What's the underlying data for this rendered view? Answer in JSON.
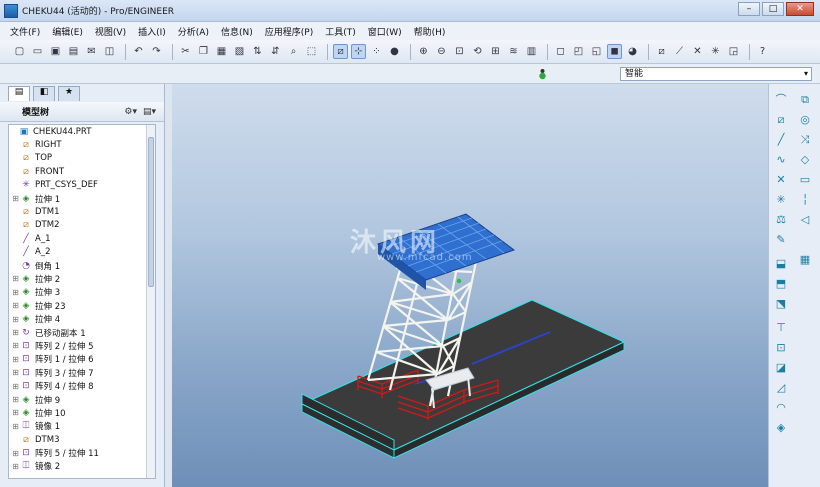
{
  "window": {
    "title": "CHEKU44 (活动的) - Pro/ENGINEER",
    "min": "–",
    "max": "□",
    "close": "✕"
  },
  "menu": [
    "文件(F)",
    "编辑(E)",
    "视图(V)",
    "插入(I)",
    "分析(A)",
    "信息(N)",
    "应用程序(P)",
    "工具(T)",
    "窗口(W)",
    "帮助(H)"
  ],
  "filter": {
    "value": "智能",
    "arrow": "▾"
  },
  "left_panel": {
    "tabs": [
      "▤",
      "◧",
      "★"
    ],
    "tree_title": "模型树",
    "tree_tools": [
      "⚙▾",
      "▤▾"
    ],
    "items": [
      {
        "exp": "",
        "icon": "▣",
        "label": "CHEKU44.PRT"
      },
      {
        "exp": "",
        "icon": "⧄",
        "label": "RIGHT"
      },
      {
        "exp": "",
        "icon": "⧄",
        "label": "TOP"
      },
      {
        "exp": "",
        "icon": "⧄",
        "label": "FRONT"
      },
      {
        "exp": "",
        "icon": "✳",
        "label": "PRT_CSYS_DEF"
      },
      {
        "exp": "⊞",
        "icon": "◈",
        "label": "拉伸 1"
      },
      {
        "exp": "",
        "icon": "⧄",
        "label": "DTM1"
      },
      {
        "exp": "",
        "icon": "⧄",
        "label": "DTM2"
      },
      {
        "exp": "",
        "icon": "╱",
        "label": "A_1"
      },
      {
        "exp": "",
        "icon": "╱",
        "label": "A_2"
      },
      {
        "exp": "",
        "icon": "◔",
        "label": "倒角 1"
      },
      {
        "exp": "⊞",
        "icon": "◈",
        "label": "拉伸 2"
      },
      {
        "exp": "⊞",
        "icon": "◈",
        "label": "拉伸 3"
      },
      {
        "exp": "⊞",
        "icon": "◈",
        "label": "拉伸 23"
      },
      {
        "exp": "⊞",
        "icon": "◈",
        "label": "拉伸 4"
      },
      {
        "exp": "⊞",
        "icon": "↻",
        "label": "已移动副本 1"
      },
      {
        "exp": "⊞",
        "icon": "⊡",
        "label": "阵列 2 / 拉伸 5"
      },
      {
        "exp": "⊞",
        "icon": "⊡",
        "label": "阵列 1 / 拉伸 6"
      },
      {
        "exp": "⊞",
        "icon": "⊡",
        "label": "阵列 3 / 拉伸 7"
      },
      {
        "exp": "⊞",
        "icon": "⊡",
        "label": "阵列 4 / 拉伸 8"
      },
      {
        "exp": "⊞",
        "icon": "◈",
        "label": "拉伸 9"
      },
      {
        "exp": "⊞",
        "icon": "◈",
        "label": "拉伸 10"
      },
      {
        "exp": "⊞",
        "icon": "⎅",
        "label": "镜像 1"
      },
      {
        "exp": "",
        "icon": "⧄",
        "label": "DTM3"
      },
      {
        "exp": "⊞",
        "icon": "⊡",
        "label": "阵列 5 / 拉伸 11"
      },
      {
        "exp": "⊞",
        "icon": "⎅",
        "label": "镜像 2"
      }
    ]
  },
  "viewport": {
    "watermark": "沐风网",
    "watermark_sub": "www.mfcad.com"
  },
  "colors": {
    "roof": "#2f6fd0",
    "frame": "#f2f2ec",
    "slab": "#3a3a3a",
    "edge": "#33e1e6",
    "rail": "#d21818"
  }
}
